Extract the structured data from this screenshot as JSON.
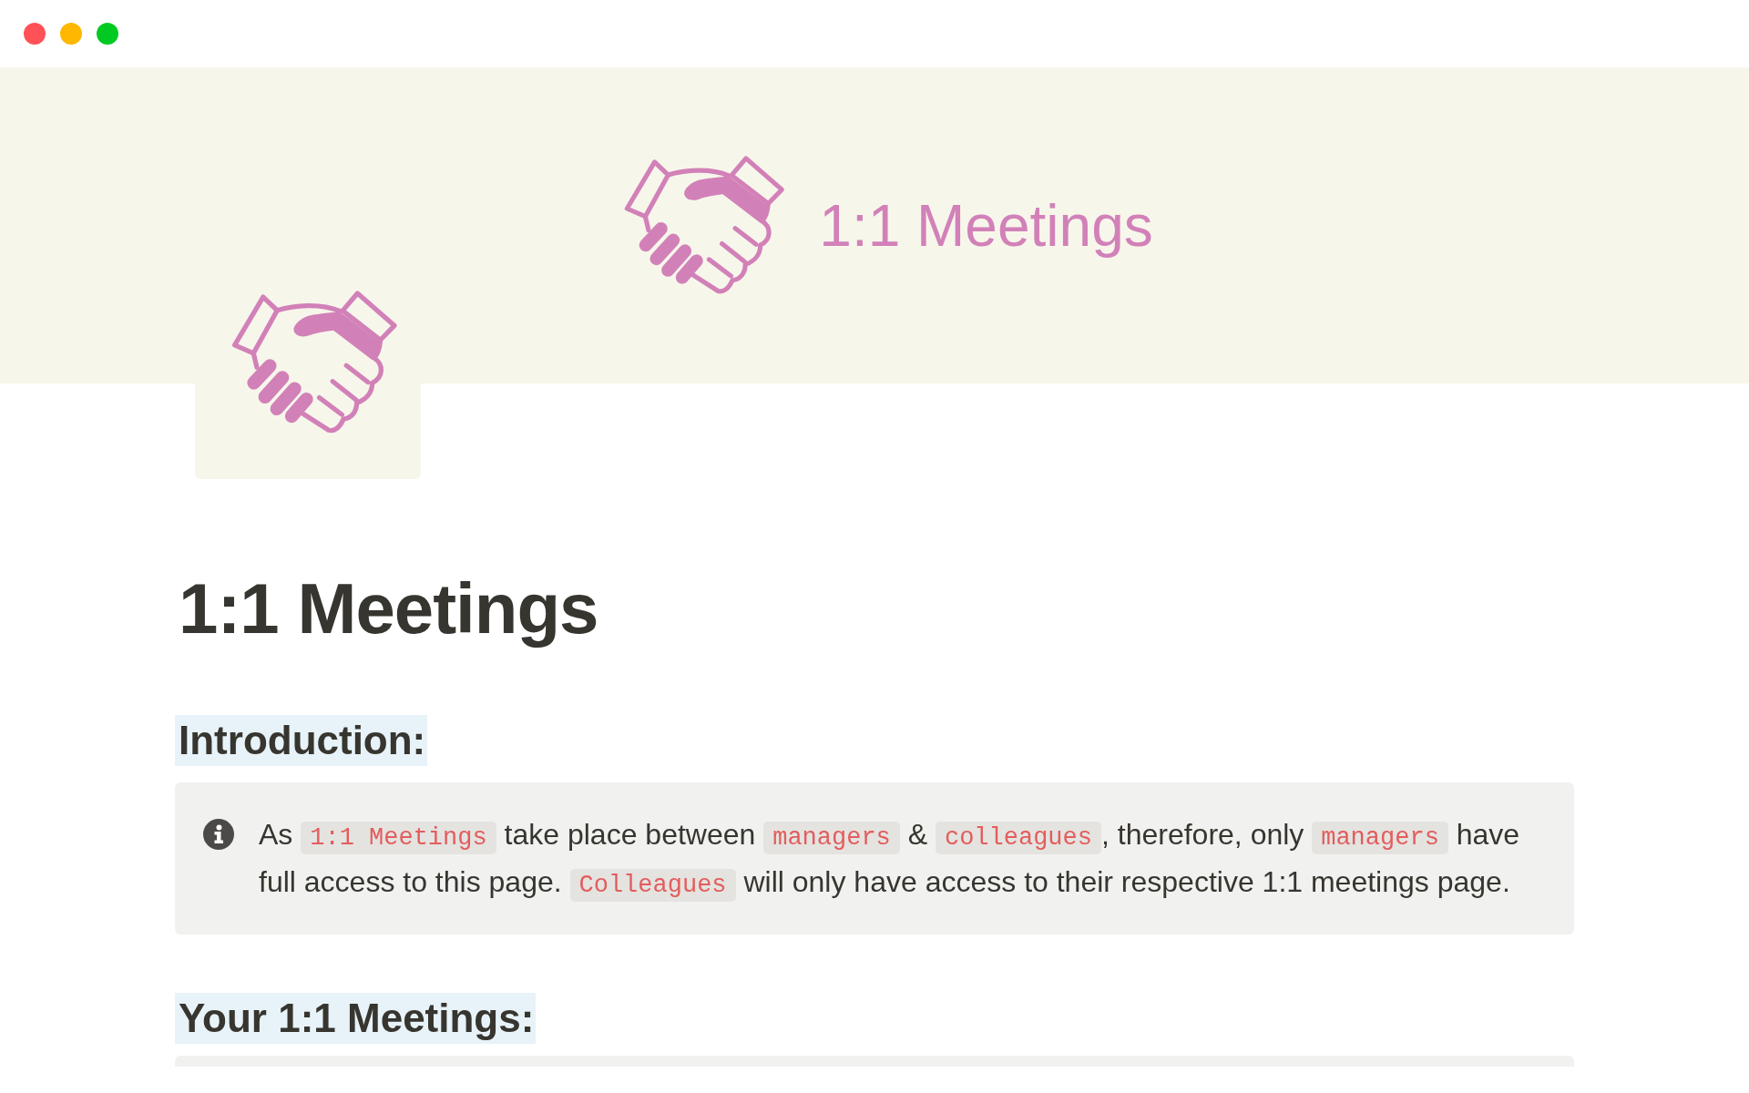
{
  "cover": {
    "title": "1:1 Meetings"
  },
  "page": {
    "title": "1:1 Meetings"
  },
  "blocks": [
    {
      "kind": "heading",
      "text": "Introduction:"
    },
    {
      "kind": "callout",
      "segments": [
        {
          "kind": "text",
          "text": "As "
        },
        {
          "kind": "code",
          "text": "1:1 Meetings"
        },
        {
          "kind": "text",
          "text": " take place between "
        },
        {
          "kind": "code",
          "text": "managers"
        },
        {
          "kind": "text",
          "text": " & "
        },
        {
          "kind": "code",
          "text": "colleagues"
        },
        {
          "kind": "text",
          "text": ", therefore, only "
        },
        {
          "kind": "code",
          "text": "managers"
        },
        {
          "kind": "text",
          "text": " have full access to this page. "
        },
        {
          "kind": "code",
          "text": "Colleagues"
        },
        {
          "kind": "text",
          "text": " will only have access to their respective 1:1 meetings page."
        }
      ]
    },
    {
      "kind": "heading",
      "text": "Your 1:1 Meetings:"
    }
  ]
}
